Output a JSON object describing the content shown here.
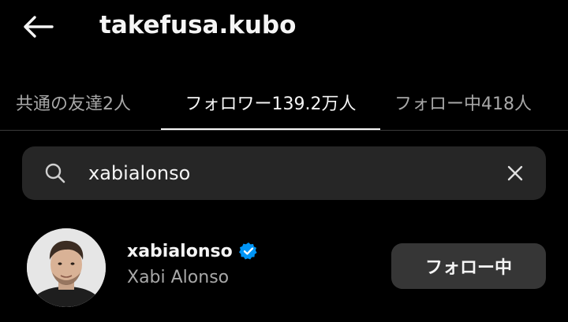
{
  "header": {
    "title": "takefusa.kubo",
    "back_icon": "arrow-left-icon"
  },
  "tabs": [
    {
      "label": "共通の友達2人",
      "active": false
    },
    {
      "label": "フォロワー139.2万人",
      "active": true
    },
    {
      "label": "フォロー中418人",
      "active": false
    }
  ],
  "search": {
    "value": "xabialonso",
    "search_icon": "search-icon",
    "clear_icon": "close-icon"
  },
  "results": [
    {
      "username": "xabialonso",
      "verified": true,
      "full_name": "Xabi Alonso",
      "button_label": "フォロー中"
    }
  ],
  "colors": {
    "background": "#000000",
    "search_bg": "#262626",
    "button_bg": "#363636",
    "verified": "#0095f6",
    "secondary_text": "#a8a8a8"
  }
}
